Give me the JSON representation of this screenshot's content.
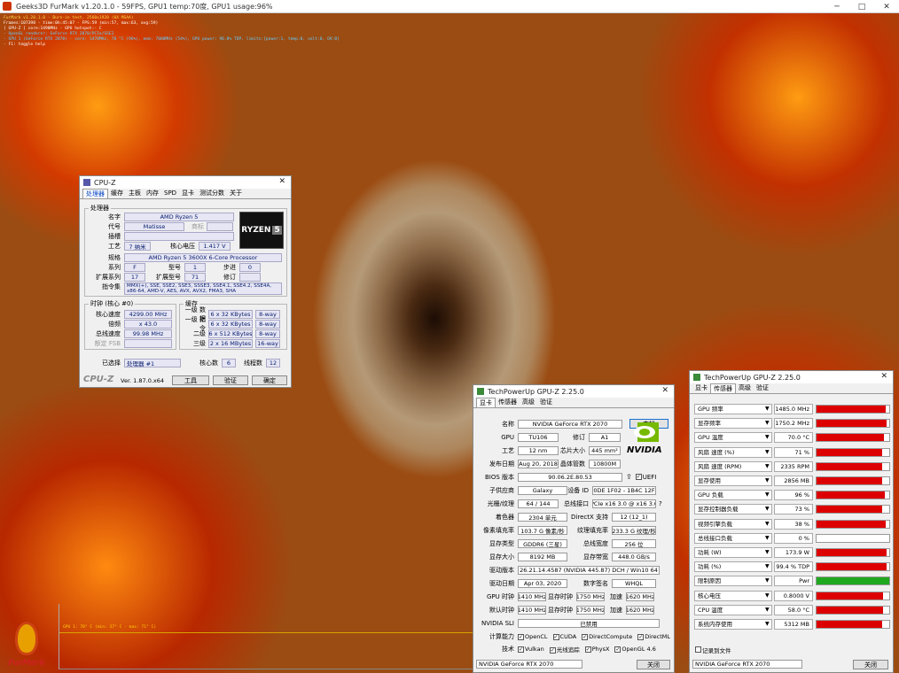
{
  "furmark": {
    "title": "Geeks3D FurMark v1.20.1.0 - 59FPS, GPU1 temp:70度, GPU1 usage:96%",
    "osd": [
      "FurMark v1.20.1.0 - Burn-in test, 2560x1920 (0X MSAA)",
      "Frames:107398 - time:0h:45:07 - FPS:59 (min:57, max:63, avg:59)",
      "[ GPU-Z ] core:1490MHz - GPU hotspot:- C",
      "- OpenGL renderer: GeForce RTX 2070/PCIe/SSE2",
      "- GPU 1 (GeForce RTX 2070) - core: 1470MHz, 70 °C (96%), mem: 7000MHz (54%), GPU power: 96.8% TDP, limits:[power:1, temp:0, volt:0, OV:0]",
      "- F1: toggle help"
    ],
    "graph_label": "GPU 1: 70° C (min: 37° C - max: 71° C)",
    "logo_text": "FurMark"
  },
  "cpuz": {
    "title": "CPU-Z",
    "tabs": [
      "处理器",
      "缓存",
      "主板",
      "内存",
      "SPD",
      "显卡",
      "测试分数",
      "关于"
    ],
    "proc_group": "处理器",
    "fields": [
      {
        "l": "名字",
        "v": "AMD Ryzen 5"
      },
      {
        "l": "代号",
        "v": "Matisse"
      },
      {
        "l": "插槽",
        "v": ""
      },
      {
        "l": "工艺",
        "v": "7 纳米"
      },
      {
        "l": "规格",
        "v": "AMD Ryzen 5 3600X 6-Core Processor"
      },
      {
        "l": "系列",
        "v": "F"
      },
      {
        "l": "扩展系列",
        "v": "17"
      }
    ],
    "trademark": "商标",
    "voltage_l": "核心电压",
    "voltage": "1.417 V",
    "model_l": "型号",
    "model": "1",
    "stepping_l": "步进",
    "stepping": "0",
    "extmodel_l": "扩展型号",
    "extmodel": "71",
    "rev_l": "修订",
    "rev": "",
    "instr_l": "指令集",
    "instr": "MMX(+), SSE, SSE2, SSE3, SSSE3, SSE4.1, SSE4.2, SSE4A, x86-64, AMD-V, AES, AVX, AVX2, FMA3, SHA",
    "clock_group": "时钟 (核心 #0)",
    "clocks": [
      {
        "l": "核心速度",
        "v": "4299.00 MHz"
      },
      {
        "l": "倍频",
        "v": "x 43.0"
      },
      {
        "l": "总线速度",
        "v": "99.98 MHz"
      },
      {
        "l": "额定 FSB",
        "v": ""
      }
    ],
    "cache_group": "缓存",
    "cache": [
      {
        "l": "一级 数据",
        "v": "6 x 32 KBytes",
        "w": "8-way"
      },
      {
        "l": "一级 指令",
        "v": "6 x 32 KBytes",
        "w": "8-way"
      },
      {
        "l": "二级",
        "v": "6 x 512 KBytes",
        "w": "8-way"
      },
      {
        "l": "三级",
        "v": "2 x 16 MBytes",
        "w": "16-way"
      }
    ],
    "selected_l": "已选择",
    "selected": "处理器 #1",
    "cores_l": "核心数",
    "cores": "6",
    "threads_l": "线程数",
    "threads": "12",
    "brand": "CPU-Z",
    "version": "Ver. 1.87.0.x64",
    "tools": "工具",
    "validate": "验证",
    "ok": "确定",
    "ryzen": "RYZEN",
    "ryzen_num": "5"
  },
  "gpuz": {
    "title": "TechPowerUp GPU-Z 2.25.0",
    "tabs": [
      "显卡",
      "传感器",
      "高级",
      "验证"
    ],
    "lookup": "查找",
    "name_l": "名称",
    "name": "NVIDIA GeForce RTX 2070",
    "gpu_l": "GPU",
    "gpu": "TU106",
    "rev_l": "修订",
    "rev": "A1",
    "tech_l": "工艺",
    "tech": "12 nm",
    "die_l": "芯片大小",
    "die": "445 mm²",
    "rel_l": "发布日期",
    "rel": "Aug 20, 2018",
    "trans_l": "晶体管数",
    "trans": "10800M",
    "bios_l": "BIOS 版本",
    "bios": "90.06.2E.80.53",
    "uefi": "UEFI",
    "sub_l": "子供应商",
    "sub": "Galaxy",
    "dev_l": "设备 ID",
    "dev": "10DE 1F02 - 1B4C 12FE",
    "rop_l": "光栅/纹理",
    "rop": "64 / 144",
    "bus_l": "总线接口",
    "bus": "PCIe x16 3.0 @ x16 3.0",
    "shader_l": "着色器",
    "shader": "2304 单元",
    "dx_l": "DirectX 支持",
    "dx": "12 (12_1)",
    "pix_l": "像素填充率",
    "pix": "103.7 G 像素/秒",
    "tex_l": "纹理填充率",
    "tex": "233.3 G 纹理/秒",
    "memt_l": "显存类型",
    "memt": "GDDR6 (三星)",
    "bw_l": "总线宽度",
    "bw": "256 位",
    "mems_l": "显存大小",
    "mems": "8192 MB",
    "band_l": "显存带宽",
    "band": "448.0 GB/s",
    "drv_l": "驱动版本",
    "drv": "26.21.14.4587 (NVIDIA 445.87) DCH / Win10 64",
    "drvd_l": "驱动日期",
    "drvd": "Apr 03, 2020",
    "sig_l": "数字签名",
    "sig": "WHQL",
    "clk_l": "GPU 时钟",
    "clk": "1410 MHz",
    "mclk_l": "显存时钟",
    "mclk": "1750 MHz",
    "boost_l": "加速",
    "boost": "1620 MHz",
    "dclk_l": "默认时钟",
    "dclk": "1410 MHz",
    "dmclk": "1750 MHz",
    "dboost": "1620 MHz",
    "sli_l": "NVIDIA SLI",
    "sli": "已禁用",
    "comp_l": "计算能力",
    "comp": [
      "OpenCL",
      "CUDA",
      "DirectCompute",
      "DirectML"
    ],
    "techs_l": "技术",
    "techs": [
      "Vulkan",
      "光线追踪",
      "PhysX",
      "OpenGL 4.6"
    ],
    "select": "NVIDIA GeForce RTX 2070",
    "close": "关闭",
    "nvidia": "NVIDIA"
  },
  "sensors": {
    "title": "TechPowerUp GPU-Z 2.25.0",
    "tabs": [
      "显卡",
      "传感器",
      "高级",
      "验证"
    ],
    "rows": [
      {
        "n": "GPU 频率",
        "v": "1485.0 MHz",
        "p": 0.95
      },
      {
        "n": "显存频率",
        "v": "1750.2 MHz",
        "p": 0.96
      },
      {
        "n": "GPU 温度",
        "v": "70.0 °C",
        "p": 0.93
      },
      {
        "n": "风扇 速度 (%)",
        "v": "71 %",
        "p": 0.9
      },
      {
        "n": "风扇 速度 (RPM)",
        "v": "2335 RPM",
        "p": 0.9
      },
      {
        "n": "显存使用",
        "v": "2856 MB",
        "p": 0.9
      },
      {
        "n": "GPU 负载",
        "v": "96 %",
        "p": 0.94
      },
      {
        "n": "显存控制器负载",
        "v": "73 %",
        "p": 0.9
      },
      {
        "n": "视频引擎负载",
        "v": "38 %",
        "p": 0.95
      },
      {
        "n": "总线接口负载",
        "v": "0 %",
        "p": 0
      },
      {
        "n": "功耗 (W)",
        "v": "173.9 W",
        "p": 0.96
      },
      {
        "n": "功耗 (%)",
        "v": "99.4 % TDP",
        "p": 0.96
      },
      {
        "n": "限制原因",
        "v": "Pwr",
        "p": 1
      },
      {
        "n": "核心电压",
        "v": "0.8000 V",
        "p": 0.92
      },
      {
        "n": "CPU 温度",
        "v": "58.0 °C",
        "p": 0.92
      },
      {
        "n": "系统内存使用",
        "v": "5312 MB",
        "p": 0.9
      }
    ],
    "log": "记录到文件",
    "select": "NVIDIA GeForce RTX 2070",
    "close": "关闭"
  }
}
